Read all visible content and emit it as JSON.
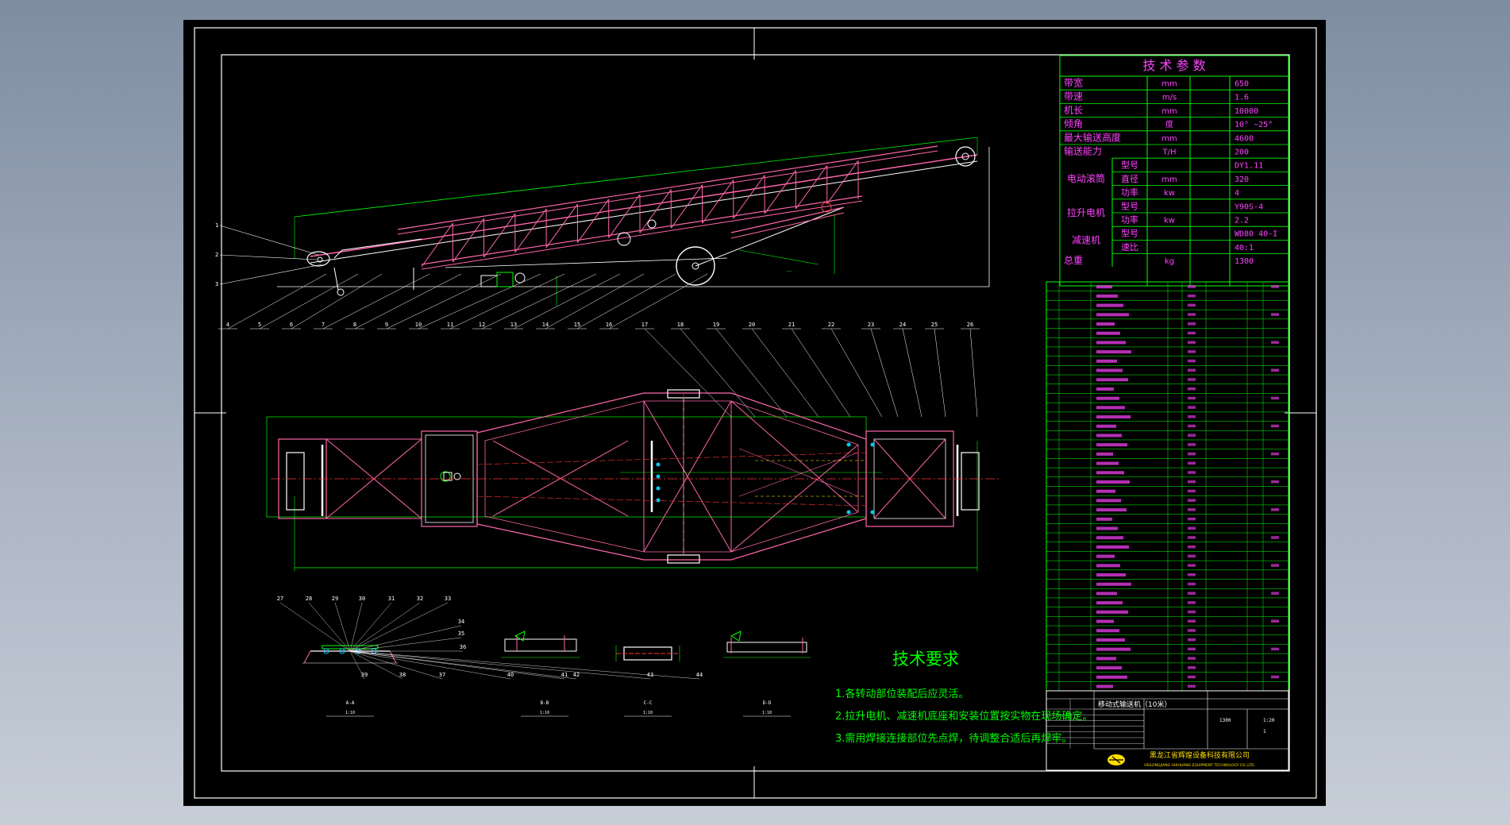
{
  "colors": {
    "background": "#000000",
    "frame": "#ffffff",
    "title_block": "#00ff00",
    "highlight": "#ff44ff",
    "structure": "#ff66aa",
    "steel": "#ffffff",
    "centerline": "#ff3333",
    "notes": "#00ff00"
  },
  "tech_params": {
    "title": "技 术 参 数",
    "rows": [
      {
        "name": "带宽",
        "sub": "",
        "unit": "mm",
        "value": "650"
      },
      {
        "name": "带速",
        "sub": "",
        "unit": "m/s",
        "value": "1.6"
      },
      {
        "name": "机长",
        "sub": "",
        "unit": "mm",
        "value": "10000"
      },
      {
        "name": "倾角",
        "sub": "",
        "unit": "度",
        "value": "10° ~25°"
      },
      {
        "name": "最大输送高度",
        "sub": "",
        "unit": "mm",
        "value": "4600"
      },
      {
        "name": "输送能力",
        "sub": "",
        "unit": "T/H",
        "value": "200"
      },
      {
        "name": "",
        "sub": "型号",
        "unit": "",
        "value": "DY1.11"
      },
      {
        "name": "电动滚筒",
        "sub": "直径",
        "unit": "mm",
        "value": "320"
      },
      {
        "name": "",
        "sub": "功率",
        "unit": "kw",
        "value": "4"
      },
      {
        "name": "拉升电机",
        "sub": "型号",
        "unit": "",
        "value": "Y90S-4"
      },
      {
        "name": "",
        "sub": "功率",
        "unit": "kw",
        "value": "2.2"
      },
      {
        "name": "减速机",
        "sub": "型号",
        "unit": "",
        "value": "WD80 40-I"
      },
      {
        "name": "",
        "sub": "速比",
        "unit": "",
        "value": "40:1"
      },
      {
        "name": "总重",
        "sub": "",
        "unit": "kg",
        "value": "1300"
      }
    ]
  },
  "balloons_top": [
    "1",
    "2",
    "3",
    "4",
    "5",
    "6",
    "7",
    "8",
    "9",
    "10",
    "11",
    "12",
    "13",
    "14",
    "15",
    "16",
    "17",
    "18",
    "19",
    "20",
    "21",
    "22",
    "23",
    "24",
    "25",
    "26"
  ],
  "balloons_bottom": [
    "27",
    "28",
    "29",
    "30",
    "31",
    "32",
    "33",
    "34",
    "35",
    "36",
    "37",
    "38",
    "39",
    "40",
    "41",
    "42",
    "43",
    "44"
  ],
  "tech_requirements": {
    "title": "技术要求",
    "items": [
      "1.各转动部位装配后应灵活。",
      "2.拉升电机、减速机底座和安装位置按实物在现场确定。",
      "3.需用焊接连接部位先点焊，待调整合适后再焊牢。"
    ]
  },
  "title_block": {
    "drawing_name": "移动式输送机（10米）",
    "company": "黑龙江省辉煌设备科技有限公司",
    "company_en": "HEILONGJIANG HUIHUANG EQUIPMENT TECHNOLOGY CO.,LTD.",
    "scale": "1:20",
    "sheet": "1",
    "weight": "1300"
  },
  "section_labels": [
    "A-A",
    "B-B",
    "C-C",
    "D-D"
  ],
  "section_scales": [
    "1:10",
    "1:10",
    "1:10",
    "1:10"
  ]
}
